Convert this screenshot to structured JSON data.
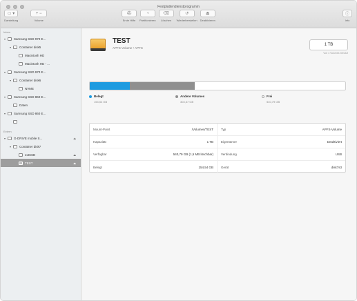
{
  "window": {
    "title": "Festplattendienstprogramm"
  },
  "toolbar": {
    "left": [
      {
        "icon": "view-icon",
        "glyph": "▭ ▾",
        "label": "Darstellung"
      },
      {
        "icon": "volume-add-remove-icon",
        "glyph": "+  −",
        "label": "Volume"
      }
    ],
    "center": [
      {
        "icon": "first-aid-icon",
        "glyph": "⛑",
        "label": "Erste Hilfe"
      },
      {
        "icon": "partition-icon",
        "glyph": "◔",
        "label": "Partitionieren"
      },
      {
        "icon": "erase-icon",
        "glyph": "⌫",
        "label": "Löschen"
      },
      {
        "icon": "restore-icon",
        "glyph": "↺",
        "label": "Wiederherstellen"
      },
      {
        "icon": "unmount-icon",
        "glyph": "⏏",
        "label": "Deaktivieren"
      }
    ],
    "right": {
      "icon": "info-icon",
      "glyph": "ⓘ",
      "label": "Info"
    }
  },
  "sidebar": {
    "sections": [
      {
        "title": "Intern",
        "items": [
          {
            "label": "Samsung SSD 970 E...",
            "level": 0,
            "disclosure": "▾",
            "eject": ""
          },
          {
            "label": "Container disk5",
            "level": 1,
            "disclosure": "▾",
            "eject": ""
          },
          {
            "label": "Macintosh HD",
            "level": 2,
            "disclosure": "",
            "eject": ""
          },
          {
            "label": "Macintosh HD - ...",
            "level": 2,
            "disclosure": "",
            "eject": ""
          },
          {
            "label": "Samsung SSD 970 E...",
            "level": 0,
            "disclosure": "▾",
            "eject": ""
          },
          {
            "label": "Container disk6",
            "level": 1,
            "disclosure": "▾",
            "eject": ""
          },
          {
            "label": "NVME",
            "level": 2,
            "disclosure": "",
            "eject": ""
          },
          {
            "label": "Samsung SSD 860 E...",
            "level": 0,
            "disclosure": "▾",
            "eject": ""
          },
          {
            "label": "Daten",
            "level": 1,
            "disclosure": "",
            "eject": ""
          },
          {
            "label": "Samsung SSD 860 E...",
            "level": 0,
            "disclosure": "▾",
            "eject": ""
          },
          {
            "label": "",
            "level": 1,
            "disclosure": "",
            "eject": ""
          }
        ]
      },
      {
        "title": "Extern",
        "items": [
          {
            "label": "G-DRIVE mobile S...",
            "level": 0,
            "disclosure": "▾",
            "eject": "⏏"
          },
          {
            "label": "Container disk7",
            "level": 1,
            "disclosure": "▾",
            "eject": ""
          },
          {
            "label": "extSSD",
            "level": 2,
            "disclosure": "",
            "eject": "⏏"
          },
          {
            "label": "TEST",
            "level": 2,
            "disclosure": "",
            "eject": "⏏",
            "selected": true
          }
        ]
      }
    ]
  },
  "volume": {
    "name": "TEST",
    "subtitle": "APFS-Volume • APFS",
    "capacity": "1 TB",
    "capacity_note": "Von 4 Volumes benutzt"
  },
  "usage": {
    "used_fraction": 0.156,
    "other_fraction": 0.255,
    "legend": [
      {
        "label": "Belegt",
        "value": "154,54 GB",
        "color": "#1e9be0"
      },
      {
        "label": "Andere Volumes",
        "value": "304,67 GB",
        "color": "#8f8f8f"
      },
      {
        "label": "Frei",
        "value": "540,79 GB",
        "color": "#ffffff"
      }
    ]
  },
  "info": {
    "rows": [
      [
        {
          "key": "Mount-Point",
          "value": "/Volumes/TEST"
        },
        {
          "key": "Typ",
          "value": "APFS-Volume"
        }
      ],
      [
        {
          "key": "Kapazität",
          "value": "1 TB"
        },
        {
          "key": "Eigentümer",
          "value": "Deaktiviert"
        }
      ],
      [
        {
          "key": "Verfügbar",
          "value": "540,79 GB (1,5 MB löschbar)"
        },
        {
          "key": "Verbindung",
          "value": "USB"
        }
      ],
      [
        {
          "key": "Belegt",
          "value": "154,54 GB"
        },
        {
          "key": "Gerät",
          "value": "disk7s3"
        }
      ]
    ]
  }
}
